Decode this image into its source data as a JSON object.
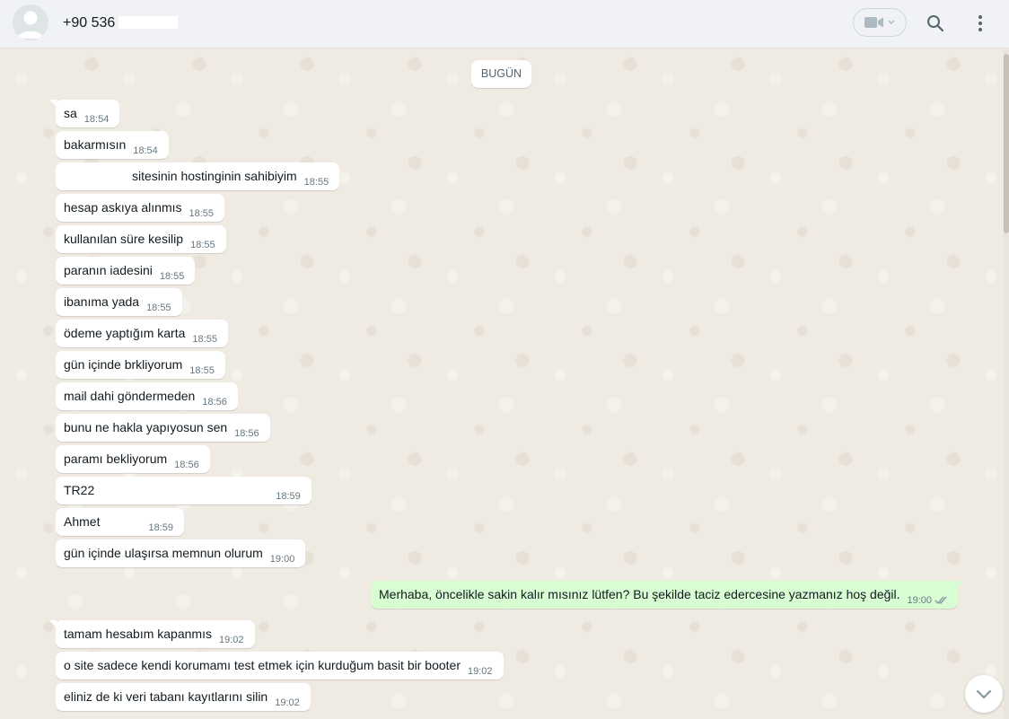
{
  "header": {
    "contact_name": "+90 536",
    "icons": {
      "avatar": "default-avatar-icon",
      "video": "video-camera-icon",
      "search": "search-icon",
      "menu": "kebab-menu-icon"
    }
  },
  "chat": {
    "date_divider": "BUGÜN",
    "messages": [
      {
        "dir": "in",
        "text": "sa",
        "time": "18:54"
      },
      {
        "dir": "in",
        "text": "bakarmısın",
        "time": "18:54"
      },
      {
        "dir": "in",
        "text": "sitesinin hostinginin sahibiyim",
        "time": "18:55"
      },
      {
        "dir": "in",
        "text": "hesap askıya alınmıs",
        "time": "18:55"
      },
      {
        "dir": "in",
        "text": "kullanılan süre kesilip",
        "time": "18:55"
      },
      {
        "dir": "in",
        "text": "paranın iadesini",
        "time": "18:55"
      },
      {
        "dir": "in",
        "text": "ibanıma yada",
        "time": "18:55"
      },
      {
        "dir": "in",
        "text": "ödeme yaptığım karta",
        "time": "18:55"
      },
      {
        "dir": "in",
        "text": "gün içinde brkliyorum",
        "time": "18:55"
      },
      {
        "dir": "in",
        "text": "mail dahi göndermeden",
        "time": "18:56"
      },
      {
        "dir": "in",
        "text": "bunu ne hakla yapıyosun sen",
        "time": "18:56"
      },
      {
        "dir": "in",
        "text": "paramı bekliyorum",
        "time": "18:56"
      },
      {
        "dir": "in",
        "text": "TR22",
        "time": "18:59"
      },
      {
        "dir": "in",
        "text": "Ahmet",
        "time": "18:59"
      },
      {
        "dir": "in",
        "text": "gün içinde ulaşırsa memnun olurum",
        "time": "19:00"
      },
      {
        "dir": "out",
        "text": "Merhaba, öncelikle sakin kalır mısınız lütfen? Bu şekilde taciz edercesine yazmanız hoş değil.",
        "time": "19:00"
      },
      {
        "dir": "in",
        "text": "tamam hesabım kapanmıs",
        "time": "19:02"
      },
      {
        "dir": "in",
        "text": "o site sadece kendi korumamı test etmek için kurduğum basit bir booter",
        "time": "19:02"
      },
      {
        "dir": "in",
        "text": "eliniz de ki veri tabanı kayıtlarını silin",
        "time": "19:02"
      }
    ]
  },
  "colors": {
    "chat_bg": "#efeae2",
    "incoming_bubble": "#ffffff",
    "outgoing_bubble": "#d9fdd3",
    "header_bg": "#f0f2f5",
    "time_text": "#667781",
    "read_ticks": "#8696a0"
  }
}
